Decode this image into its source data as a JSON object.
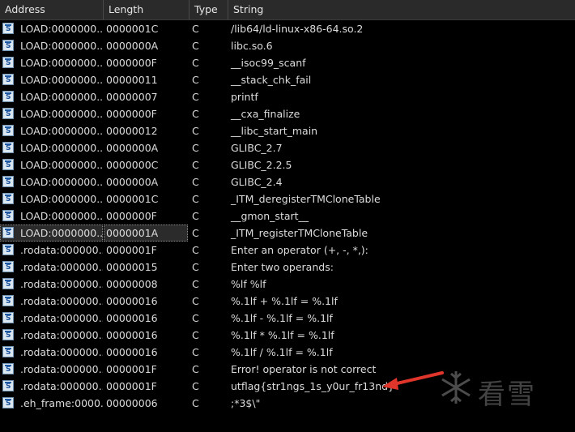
{
  "columns": {
    "address": "Address",
    "length": "Length",
    "type": "Type",
    "string": "String"
  },
  "rows": [
    {
      "address": "LOAD:0000000...",
      "length": "0000001C",
      "type": "C",
      "string": "/lib64/ld-linux-x86-64.so.2"
    },
    {
      "address": "LOAD:0000000...",
      "length": "0000000A",
      "type": "C",
      "string": "libc.so.6"
    },
    {
      "address": "LOAD:0000000...",
      "length": "0000000F",
      "type": "C",
      "string": "__isoc99_scanf"
    },
    {
      "address": "LOAD:0000000...",
      "length": "00000011",
      "type": "C",
      "string": "__stack_chk_fail"
    },
    {
      "address": "LOAD:0000000...",
      "length": "00000007",
      "type": "C",
      "string": "printf"
    },
    {
      "address": "LOAD:0000000...",
      "length": "0000000F",
      "type": "C",
      "string": "__cxa_finalize"
    },
    {
      "address": "LOAD:0000000...",
      "length": "00000012",
      "type": "C",
      "string": "__libc_start_main"
    },
    {
      "address": "LOAD:0000000...",
      "length": "0000000A",
      "type": "C",
      "string": "GLIBC_2.7"
    },
    {
      "address": "LOAD:0000000...",
      "length": "0000000C",
      "type": "C",
      "string": "GLIBC_2.2.5"
    },
    {
      "address": "LOAD:0000000...",
      "length": "0000000A",
      "type": "C",
      "string": "GLIBC_2.4"
    },
    {
      "address": "LOAD:0000000...",
      "length": "0000001C",
      "type": "C",
      "string": "_ITM_deregisterTMCloneTable"
    },
    {
      "address": "LOAD:0000000...",
      "length": "0000000F",
      "type": "C",
      "string": "__gmon_start__"
    },
    {
      "address": "LOAD:0000000...",
      "length": "0000001A",
      "type": "C",
      "string": "_ITM_registerTMCloneTable"
    },
    {
      "address": ".rodata:000000...",
      "length": "0000001F",
      "type": "C",
      "string": "Enter an operator (+, -, *,):"
    },
    {
      "address": ".rodata:000000...",
      "length": "00000015",
      "type": "C",
      "string": "Enter two operands:"
    },
    {
      "address": ".rodata:000000...",
      "length": "00000008",
      "type": "C",
      "string": "%lf %lf"
    },
    {
      "address": ".rodata:000000...",
      "length": "00000016",
      "type": "C",
      "string": "%.1lf + %.1lf = %.1lf"
    },
    {
      "address": ".rodata:000000...",
      "length": "00000016",
      "type": "C",
      "string": "%.1lf - %.1lf = %.1lf"
    },
    {
      "address": ".rodata:000000...",
      "length": "00000016",
      "type": "C",
      "string": "%.1lf * %.1lf = %.1lf"
    },
    {
      "address": ".rodata:000000...",
      "length": "00000016",
      "type": "C",
      "string": "%.1lf / %.1lf = %.1lf"
    },
    {
      "address": ".rodata:000000...",
      "length": "0000001F",
      "type": "C",
      "string": "Error! operator is not correct"
    },
    {
      "address": ".rodata:000000...",
      "length": "0000001F",
      "type": "C",
      "string": "utflag{str1ngs_1s_y0ur_fr13nd}"
    },
    {
      "address": ".eh_frame:0000...",
      "length": "00000006",
      "type": "C",
      "string": ";*3$\\\""
    }
  ],
  "selected_row_index": 12,
  "watermark_text": "看雪",
  "colors": {
    "background": "#000000",
    "header_bg": "#2a2a2a",
    "text": "#dcdcdc",
    "arrow": "#e0352b"
  }
}
